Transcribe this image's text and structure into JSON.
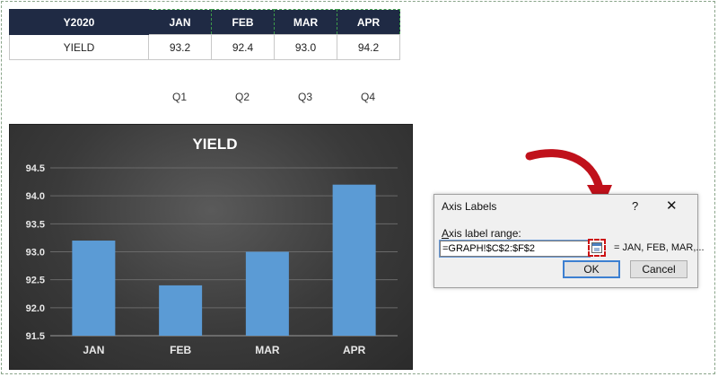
{
  "sheet": {
    "header": [
      "Y2020",
      "JAN",
      "FEB",
      "MAR",
      "APR"
    ],
    "row": [
      "YIELD",
      "93.2",
      "92.4",
      "93.0",
      "94.2"
    ],
    "quarters": [
      "Q1",
      "Q2",
      "Q3",
      "Q4"
    ]
  },
  "chart_data": {
    "type": "bar",
    "title": "YIELD",
    "categories": [
      "JAN",
      "FEB",
      "MAR",
      "APR"
    ],
    "values": [
      93.2,
      92.4,
      93.0,
      94.2
    ],
    "ylim": [
      91.5,
      94.5
    ],
    "yticks": [
      "94.5",
      "94.0",
      "93.5",
      "93.0",
      "92.5",
      "92.0",
      "91.5"
    ],
    "grid": true,
    "bar_color": "#5b9bd5",
    "background_color": "#3a3a3a"
  },
  "dialog": {
    "title": "Axis Labels",
    "help": "?",
    "close": "✕",
    "label_accesskey": "A",
    "label_rest": "xis label range:",
    "range_value": "=GRAPH!$C$2:$F$2",
    "preview": "= JAN, FEB, MAR,...",
    "ok": "OK",
    "cancel": "Cancel"
  },
  "colors": {
    "header_bg": "#1f2a44",
    "arrow": "#c0111b",
    "highlight": "#cc1111"
  }
}
